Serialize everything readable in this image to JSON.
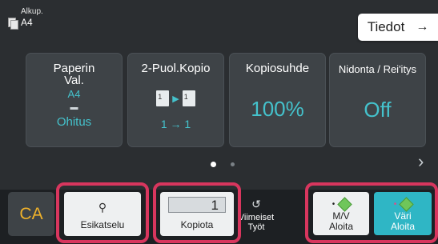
{
  "original": {
    "label": "Alkup.",
    "size": "A4",
    "icon": "original-document-icon"
  },
  "info_button": {
    "label": "Tiedot",
    "arrow": "→"
  },
  "tiles": {
    "paper": {
      "title_line1": "Paperin",
      "title_line2": "Val.",
      "size": "A4",
      "tray_icon": "paper-tray-icon",
      "value": "Ohitus"
    },
    "duplex": {
      "title": "2-Puol.Kopio",
      "value": "1 → 1",
      "icon": "duplex-copy-icon"
    },
    "ratio": {
      "title": "Kopiosuhde",
      "value": "100%"
    },
    "staple": {
      "title": "Nidonta / Rei'itys",
      "value": "Off"
    }
  },
  "pager": {
    "current": 1,
    "total": 2,
    "next_icon": "chevron-right-icon"
  },
  "bottom": {
    "ca": "CA",
    "preview": {
      "label": "Esikatselu",
      "icon": "preview-magnifier-icon"
    },
    "copies": {
      "value": "1",
      "label": "Kopiota"
    },
    "recent_jobs": {
      "line1": "Viimeiset",
      "line2": "Työt",
      "icon": "history-icon"
    },
    "mono_start": {
      "line1": "M/V",
      "line2": "Aloita"
    },
    "color_start": {
      "line1": "Väri",
      "line2": "Aloita"
    }
  },
  "colors": {
    "accent": "#44c2cc",
    "highlight": "#d8365e",
    "ca": "#f0b22a",
    "color_start": "#2fb6c5"
  }
}
